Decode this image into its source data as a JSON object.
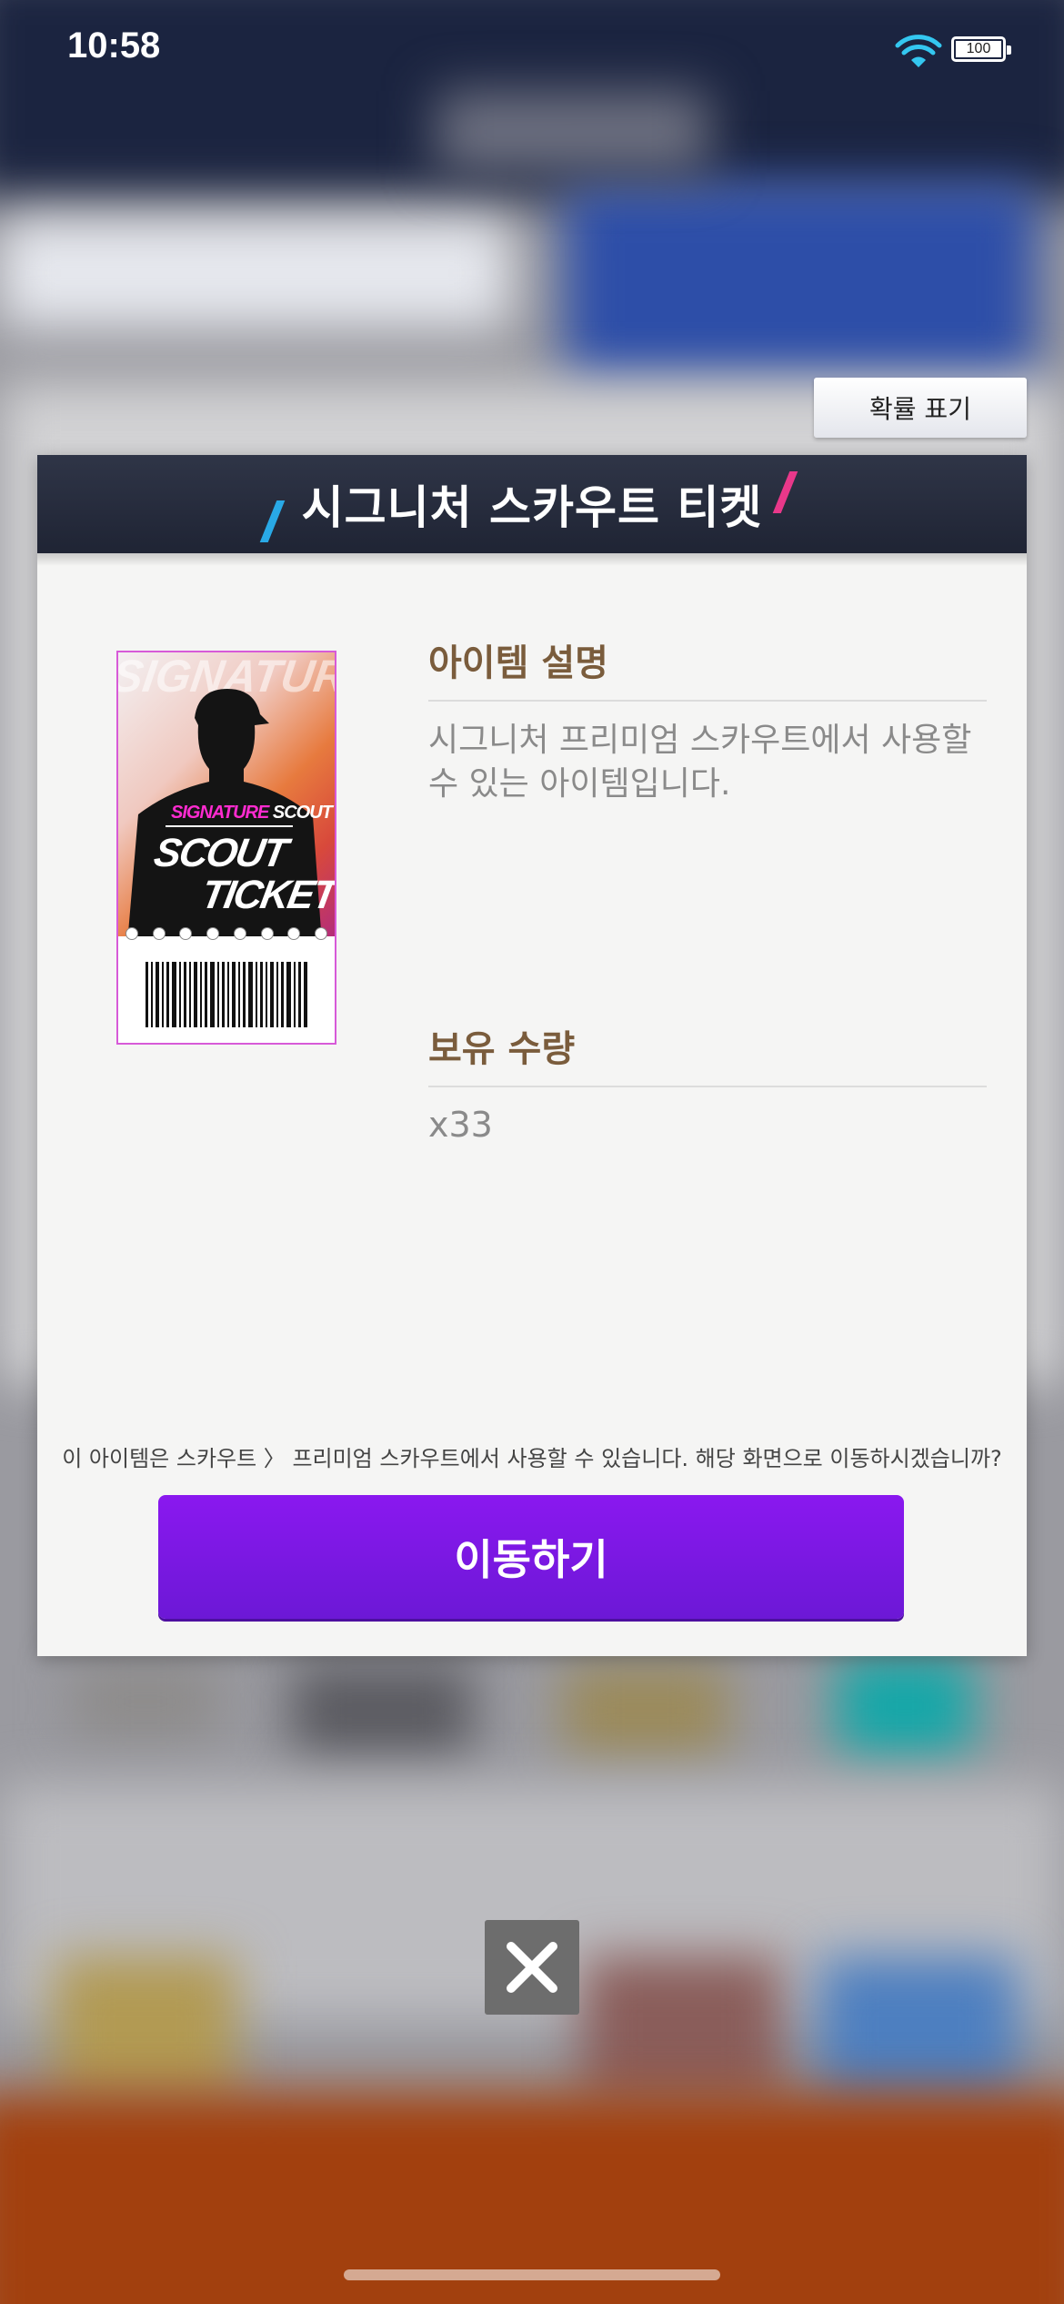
{
  "status_bar": {
    "time": "10:58",
    "battery": "100"
  },
  "dialog": {
    "probability_button": "확률 표기",
    "title": "시그니처 스카우트 티켓",
    "ticket_art": {
      "line1": "SIGNATURE",
      "line2": "SCOUT",
      "word1": "SCOUT",
      "word2": "TICKET"
    },
    "description_title": "아이템 설명",
    "description": "시그니처 프리미엄 스카우트에서 사용할 수 있는 아이템입니다.",
    "quantity_title": "보유 수량",
    "quantity": "x33",
    "notice": "이 아이템은 스카우트 〉 프리미엄 스카우트에서 사용할 수 있습니다. 해당 화면으로 이동하시겠습니까?",
    "move_button": "이동하기"
  },
  "icons": {
    "wifi": "wifi-icon",
    "battery": "battery-icon",
    "close": "close-icon"
  },
  "colors": {
    "header": "#2a3040",
    "button": "#7a17e6",
    "section_title": "#7a5c3c"
  }
}
